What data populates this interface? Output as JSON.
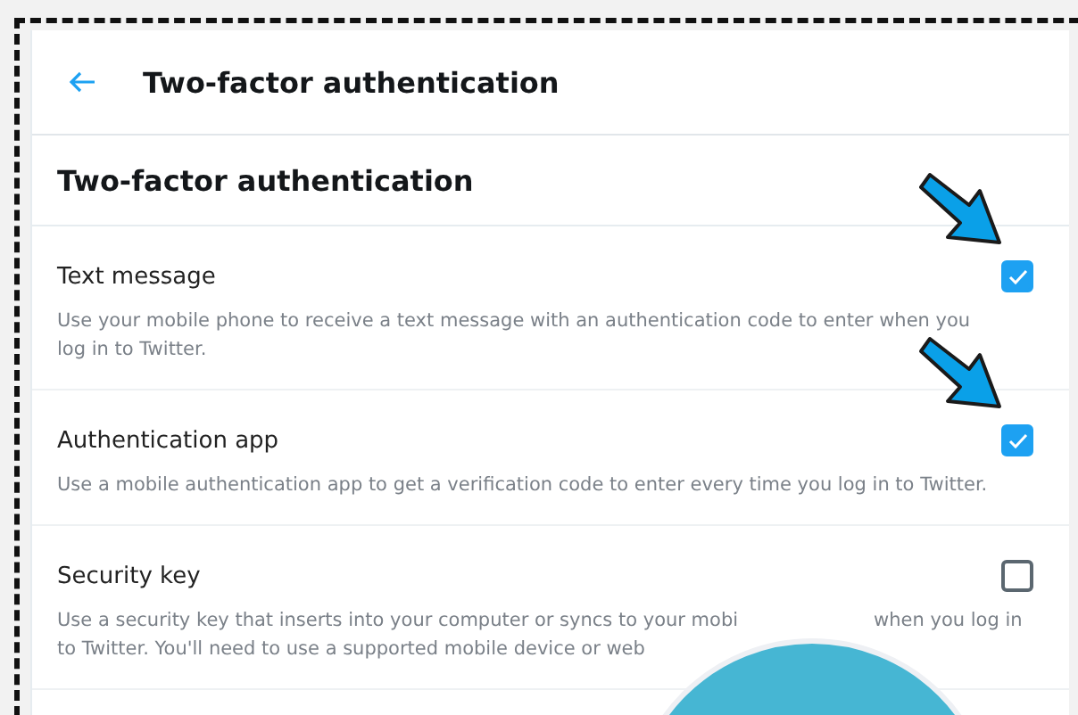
{
  "header": {
    "title": "Two-factor authentication"
  },
  "section": {
    "heading": "Two-factor authentication"
  },
  "options": [
    {
      "label": "Text message",
      "checked": true,
      "pointed": true,
      "description_lines": [
        [
          "Use your mobile phone to receive a text message with an authentication code to enter when you"
        ],
        [
          "log in to Twitter."
        ]
      ]
    },
    {
      "label": "Authentication app",
      "checked": true,
      "pointed": true,
      "description_lines": [
        [
          "Use a mobile authentication app to get a verification code to enter every time you log in to Twitter."
        ]
      ]
    },
    {
      "label": "Security key",
      "checked": false,
      "pointed": false,
      "description_lines": [
        [
          "Use a security key that inserts into your computer or syncs to your mobi",
          "when you log in"
        ],
        [
          "to Twitter. You'll need to use a supported mobile device or web"
        ]
      ]
    }
  ]
}
